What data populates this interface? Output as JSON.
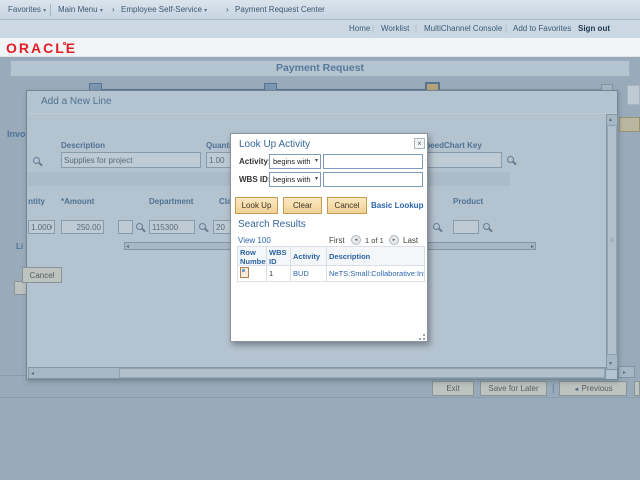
{
  "icons": {
    "dropdown": "▾",
    "caret": "▾",
    "crumb_sep": "›",
    "pipe": "|",
    "left": "◂",
    "right": "▸",
    "up": "▴",
    "down": "▾",
    "grip": "≡",
    "close": "×",
    "prev": "◄"
  },
  "breadcrumb": {
    "favorites": "Favorites",
    "main_menu": "Main Menu",
    "employee_self_service": "Employee Self-Service",
    "payment_request_center": "Payment Request Center"
  },
  "header_links": {
    "home": "Home",
    "worklist": "Worklist",
    "multichannel": "MultiChannel Console",
    "add_to_favorites": "Add to Favorites",
    "sign_out": "Sign out"
  },
  "brand": {
    "logo": "ORACLE"
  },
  "page": {
    "title": "Payment Request"
  },
  "background": {
    "invoice_fragment": "Invo",
    "line_fragment": "Li",
    "exit": "Exit",
    "save_for_later": "Save for Later",
    "previous": "Previous"
  },
  "add_line_modal": {
    "title": "Add a New Line",
    "fields": {
      "description_label": "Description",
      "description_value": "Supplies for project",
      "quantity_label": "Quantity",
      "quantity_value": "1.00",
      "speedchart_label": "SpeedChart Key"
    },
    "grid": {
      "headers": {
        "quantity": "Quantity",
        "amount": "*Amount",
        "department": "Department",
        "class_": "Class",
        "product": "Product"
      },
      "row": {
        "quantity": "1.0000",
        "amount": "250.00",
        "department": "115300",
        "class_": "20"
      }
    },
    "cancel": "Cancel"
  },
  "lookup_dialog": {
    "title": "Look Up Activity",
    "rows": [
      {
        "label": "Activity:",
        "operator": "begins with"
      },
      {
        "label": "WBS ID:",
        "operator": "begins with"
      }
    ],
    "buttons": {
      "look_up": "Look Up",
      "clear": "Clear",
      "cancel": "Cancel"
    },
    "basic_lookup": "Basic Lookup",
    "search_results": "Search Results",
    "view": "View 100",
    "pagination": {
      "first": "First",
      "page": "1 of 1",
      "last": "Last"
    },
    "table": {
      "headers": [
        "Row Number",
        "WBS ID",
        "Activity",
        "Description"
      ],
      "row": {
        "wbs_id": "1",
        "activity": "BUD",
        "description": "NeTS:Small:Collaborative:Infra"
      }
    }
  }
}
